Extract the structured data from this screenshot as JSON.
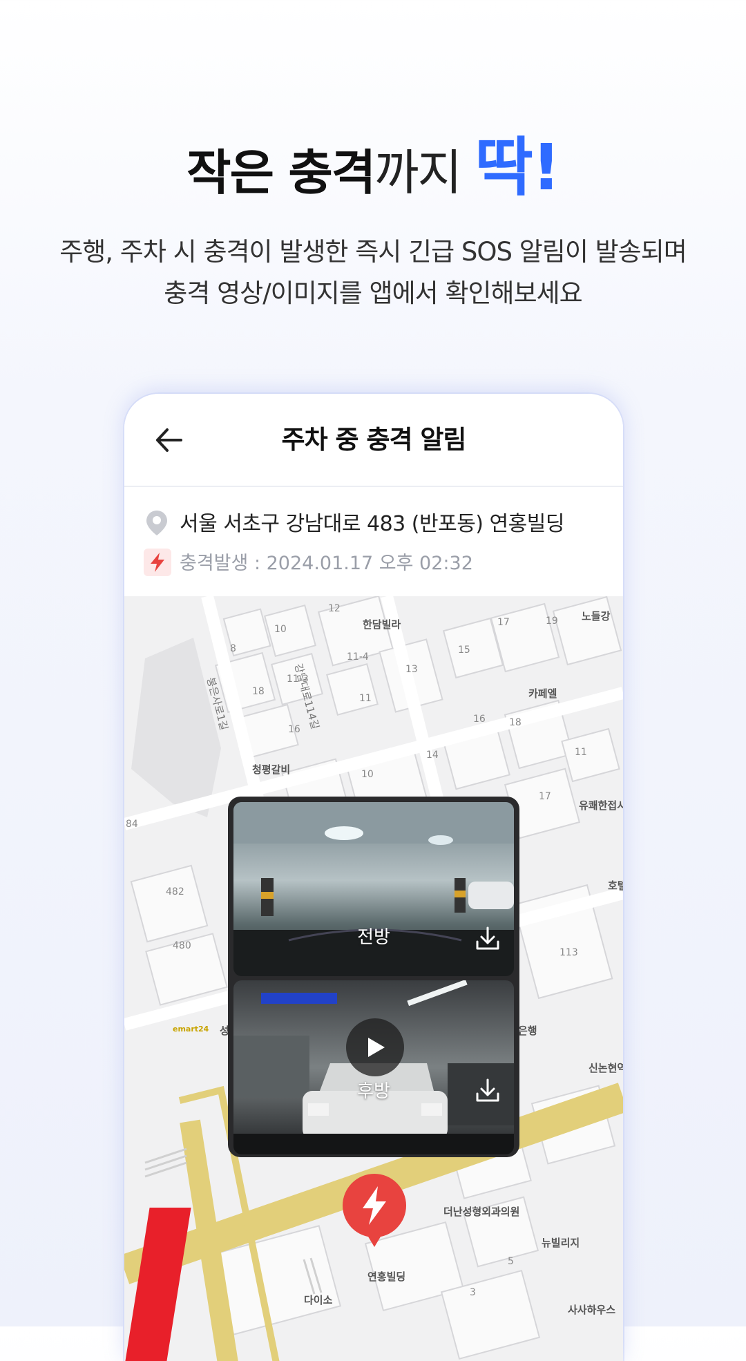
{
  "headline": {
    "part1": "작은 충격",
    "part2": "까지 ",
    "part3": "딱!"
  },
  "subcopy": {
    "line1": "주행, 주차 시 충격이 발생한 즉시 긴급 SOS 알림이 발송되며",
    "line2": "충격 영상/이미지를 앱에서 확인해보세요"
  },
  "app": {
    "title": "주차 중 충격 알림",
    "back_icon": "arrow-left-icon",
    "address": "서울 서초구 강남대로 483 (반포동) 연홍빌딩",
    "impact_time": "충격발생 : 2024.01.17 오후 02:32"
  },
  "videos": {
    "front_label": "전방",
    "rear_label": "후방"
  },
  "map": {
    "labels": {
      "handam": "한담빌라",
      "noeul": "노들강",
      "cafe": "카페엘",
      "cheongpyeong": "청평갈비",
      "yukwae": "유쾌한접시",
      "hotel": "호텔",
      "emart": "emart24",
      "bank": "은행",
      "sinnonhyeon": "신논현역",
      "deonan": "더난성형외과의원",
      "newbridge": "뉴빌리지",
      "yeonhong": "연홍빌딩",
      "daiso": "다이소",
      "saha": "사사하우스",
      "road1": "강남대로114길",
      "road2": "봉은사로1길",
      "seong": "성"
    },
    "numbers": [
      "12",
      "10",
      "8",
      "18",
      "11-3",
      "16",
      "11-4",
      "13",
      "11",
      "17",
      "19",
      "15",
      "16",
      "18",
      "14",
      "11",
      "10",
      "17",
      "84",
      "482",
      "480",
      "113",
      "5",
      "3"
    ]
  },
  "colors": {
    "accent": "#2f6bff",
    "alert_red": "#e8433f",
    "road_yellow": "#e2cf7a"
  }
}
